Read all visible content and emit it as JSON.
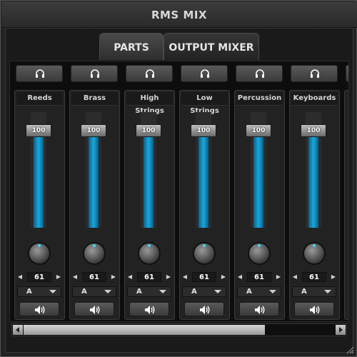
{
  "window": {
    "title": "RMS MIX"
  },
  "tabs": [
    {
      "label": "PARTS",
      "active": true
    },
    {
      "label": "OUTPUT MIXER",
      "active": false
    }
  ],
  "parts": [
    {
      "name": "Reeds",
      "level": "100",
      "level_fraction": 0.85,
      "stepper": "61",
      "output": "A"
    },
    {
      "name": "Brass",
      "level": "100",
      "level_fraction": 0.85,
      "stepper": "61",
      "output": "A"
    },
    {
      "name": "High Strings",
      "level": "100",
      "level_fraction": 0.85,
      "stepper": "61",
      "output": "A"
    },
    {
      "name": "Low Strings",
      "level": "100",
      "level_fraction": 0.85,
      "stepper": "61",
      "output": "A"
    },
    {
      "name": "Percussion",
      "level": "100",
      "level_fraction": 0.85,
      "stepper": "61",
      "output": "A"
    },
    {
      "name": "Keyboards",
      "level": "100",
      "level_fraction": 0.85,
      "stepper": "61",
      "output": "A"
    }
  ],
  "icons": {
    "solo": "headphones-icon",
    "mute": "speaker-icon",
    "stepper_left": "arrow-left-icon",
    "stepper_right": "arrow-right-icon"
  },
  "colors": {
    "fader": "#1aa8dd",
    "background": "#1b1b1b"
  }
}
